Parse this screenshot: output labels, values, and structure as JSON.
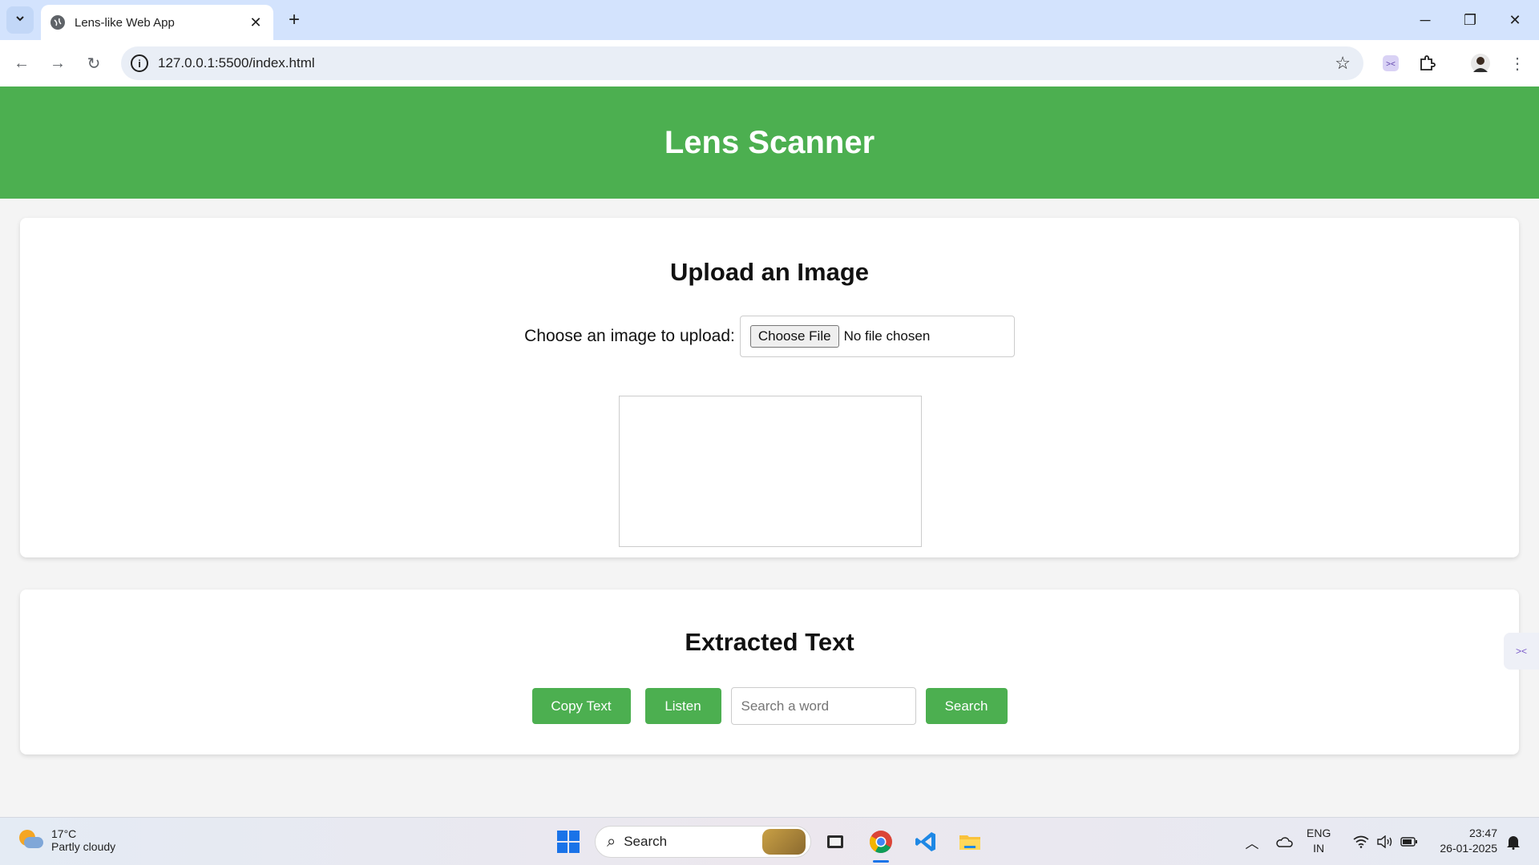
{
  "browser": {
    "tab_title": "Lens-like Web App",
    "url": "127.0.0.1:5500/index.html"
  },
  "page": {
    "header_title": "Lens Scanner",
    "upload_section": {
      "heading": "Upload an Image",
      "label": "Choose an image to upload:",
      "choose_file_label": "Choose File",
      "file_status": "No file chosen"
    },
    "extract_section": {
      "heading": "Extracted Text",
      "copy_label": "Copy Text",
      "listen_label": "Listen",
      "search_placeholder": "Search a word",
      "search_label": "Search"
    }
  },
  "taskbar": {
    "weather_temp": "17°C",
    "weather_condition": "Partly cloudy",
    "search_label": "Search",
    "lang_top": "ENG",
    "lang_bottom": "IN",
    "time": "23:47",
    "date": "26-01-2025"
  },
  "colors": {
    "accent_green": "#4caf50",
    "tabstrip": "#d3e3fd"
  }
}
